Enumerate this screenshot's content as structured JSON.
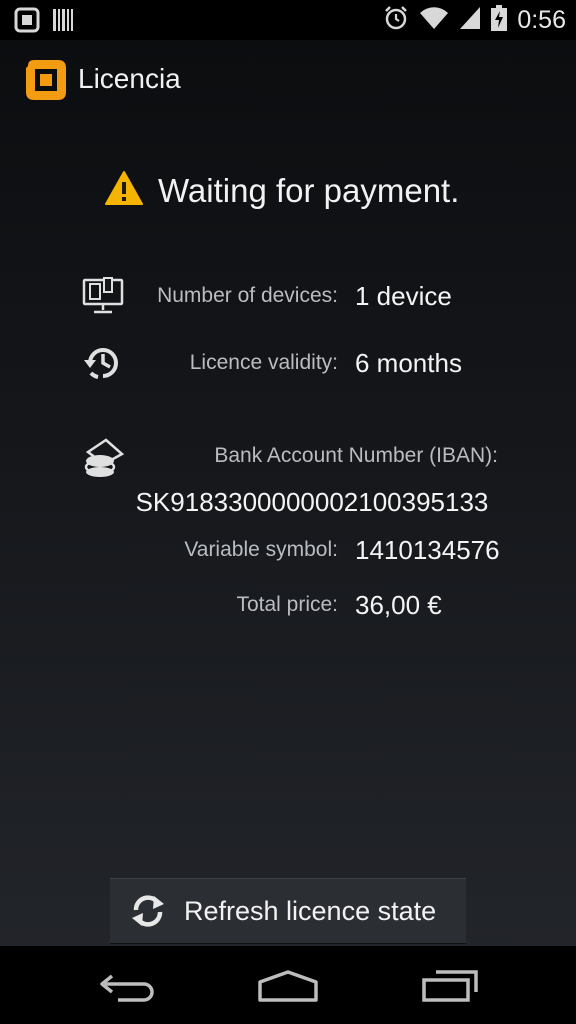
{
  "status_bar": {
    "time": "0:56",
    "icons": [
      "app-notification-icon",
      "barcode-icon",
      "alarm-icon",
      "wifi-icon",
      "signal-icon",
      "battery-charging-icon"
    ]
  },
  "action_bar": {
    "title": "Licencia",
    "logo_icon": "licencia-logo-icon"
  },
  "content": {
    "status_icon": "warning-icon",
    "status_text": "Waiting for payment.",
    "devices_label": "Number of devices:",
    "devices_value": "1 device",
    "validity_label": "Licence validity:",
    "validity_value": "6 months",
    "bank_label": "Bank Account Number (IBAN):",
    "iban": "SK9183300000002100395133",
    "variable_symbol_label": "Variable symbol:",
    "variable_symbol_value": "1410134576",
    "total_price_label": "Total price:",
    "total_price_value": "36,00 €"
  },
  "refresh_button": {
    "label": "Refresh licence state",
    "icon": "refresh-icon"
  },
  "nav_bar": {
    "buttons": [
      "back-icon",
      "home-icon",
      "recent-apps-icon"
    ]
  },
  "colors": {
    "accent": "#f39c12",
    "warning": "#f5b400",
    "background_top": "#0b0c0e",
    "background_bottom": "#24272c"
  }
}
